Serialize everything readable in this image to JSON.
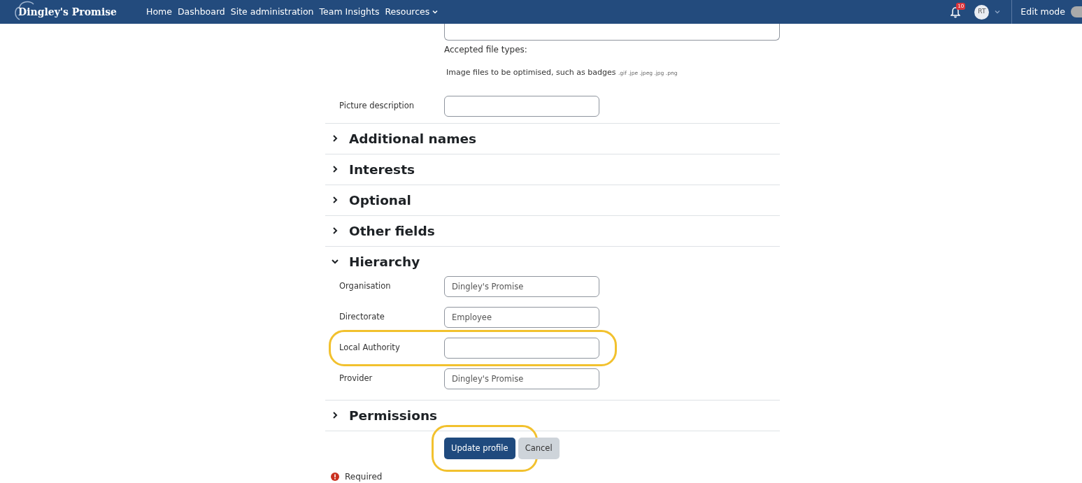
{
  "navbar": {
    "brand": "Dingley's Promise",
    "links": [
      {
        "label": "Home",
        "dropdown": false
      },
      {
        "label": "Dashboard",
        "dropdown": false
      },
      {
        "label": "Site administration",
        "dropdown": false
      },
      {
        "label": "Team Insights",
        "dropdown": false
      },
      {
        "label": "Resources",
        "dropdown": true
      }
    ],
    "notifications": "10",
    "avatar": "RT",
    "edit_mode": {
      "label": "Edit mode",
      "on": false
    }
  },
  "file_field": {
    "accepted_label": "Accepted file types:",
    "types_text": "Image files to be optimised, such as badges",
    "extensions": ".gif .jpe .jpeg .jpg .png"
  },
  "picture_description": {
    "label": "Picture description"
  },
  "sections": [
    {
      "title": "Additional names",
      "expanded": false
    },
    {
      "title": "Interests",
      "expanded": false
    },
    {
      "title": "Optional",
      "expanded": false
    },
    {
      "title": "Other fields",
      "expanded": false
    },
    {
      "title": "Hierarchy",
      "expanded": true,
      "fields": [
        {
          "label": "Organisation",
          "value": "Dingley's Promise",
          "highlighted": false
        },
        {
          "label": "Directorate",
          "value": "Employee",
          "highlighted": false
        },
        {
          "label": "Local Authority",
          "highlighted": true
        },
        {
          "label": "Provider",
          "value": "Dingley's Promise",
          "highlighted": false
        }
      ]
    },
    {
      "title": "Permissions",
      "expanded": false
    }
  ],
  "buttons": [
    {
      "label": "Update profile",
      "kind": "primary",
      "highlighted": true
    },
    {
      "label": "Cancel",
      "kind": "secondary",
      "highlighted": false
    }
  ],
  "required_note": "Required"
}
